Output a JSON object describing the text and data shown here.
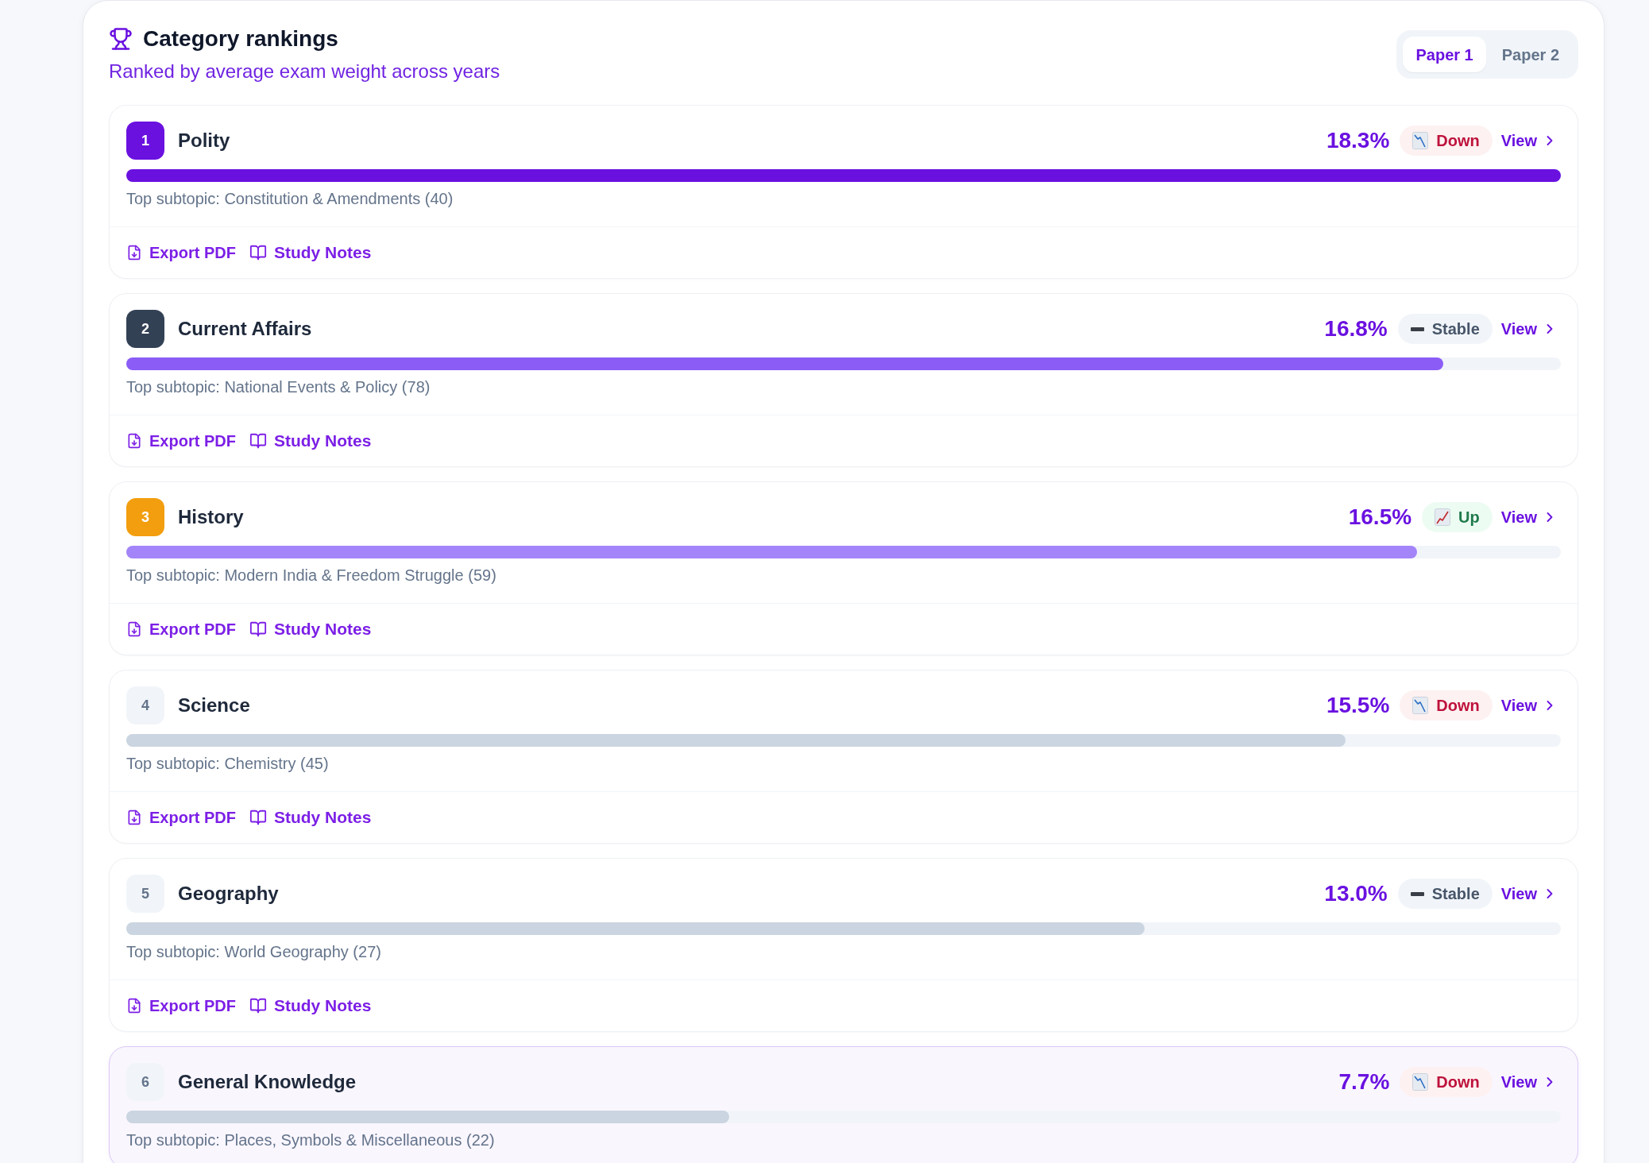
{
  "panel": {
    "title": "Category rankings",
    "subtitle": "Ranked by average exam weight across years",
    "tabs": [
      {
        "label": "Paper 1",
        "selected": true
      },
      {
        "label": "Paper 2",
        "selected": false
      }
    ]
  },
  "categories": [
    {
      "rank": "1",
      "name": "Polity",
      "color": "#6a11e0",
      "share": "18.3%",
      "trend": {
        "kind": "down",
        "label": "Down"
      },
      "link": "View",
      "bar": {
        "level": 1,
        "color": "#6a11e0"
      },
      "top_subtopic": "Top subtopic: Constitution & Amendments (40)",
      "actions": [
        {
          "kind": "export",
          "label": "Export PDF"
        },
        {
          "kind": "notes",
          "label": "Study Notes"
        }
      ],
      "highlighted": false
    },
    {
      "rank": "2",
      "name": "Current Affairs",
      "color": "#334155",
      "share": "16.8%",
      "trend": {
        "kind": "stable",
        "label": "Stable"
      },
      "link": "View",
      "bar": {
        "level": 0.918,
        "color": "#8b5cf6"
      },
      "top_subtopic": "Top subtopic: National Events & Policy (78)",
      "actions": [
        {
          "kind": "export",
          "label": "Export PDF"
        },
        {
          "kind": "notes",
          "label": "Study Notes"
        }
      ],
      "highlighted": false
    },
    {
      "rank": "3",
      "name": "History",
      "color": "#f29e0e",
      "share": "16.5%",
      "trend": {
        "kind": "up",
        "label": "Up"
      },
      "link": "View",
      "bar": {
        "level": 0.9,
        "color": "#a385f9"
      },
      "top_subtopic": "Top subtopic: Modern India & Freedom Struggle (59)",
      "actions": [
        {
          "kind": "export",
          "label": "Export PDF"
        },
        {
          "kind": "notes",
          "label": "Study Notes"
        }
      ],
      "highlighted": false
    },
    {
      "rank": "4",
      "name": "Science",
      "color": "#f1f5f9",
      "share": "15.5%",
      "trend": {
        "kind": "down",
        "label": "Down"
      },
      "link": "View",
      "bar": {
        "level": 0.85,
        "color": "#cbd5e1"
      },
      "top_subtopic": "Top subtopic: Chemistry (45)",
      "actions": [
        {
          "kind": "export",
          "label": "Export PDF"
        },
        {
          "kind": "notes",
          "label": "Study Notes"
        }
      ],
      "highlighted": false
    },
    {
      "rank": "5",
      "name": "Geography",
      "color": "#f1f5f9",
      "share": "13.0%",
      "trend": {
        "kind": "stable",
        "label": "Stable"
      },
      "link": "View",
      "bar": {
        "level": 0.71,
        "color": "#cbd5e1"
      },
      "top_subtopic": "Top subtopic: World Geography (27)",
      "actions": [
        {
          "kind": "export",
          "label": "Export PDF"
        },
        {
          "kind": "notes",
          "label": "Study Notes"
        }
      ],
      "highlighted": false
    },
    {
      "rank": "6",
      "name": "General Knowledge",
      "color": "#f1f5f9",
      "share": "7.7%",
      "trend": {
        "kind": "down",
        "label": "Down"
      },
      "link": "View",
      "bar": {
        "level": 0.42,
        "color": "#cbd5e1"
      },
      "top_subtopic": "Top subtopic: Places, Symbols & Miscellaneous (22)",
      "highlighted": true
    }
  ]
}
